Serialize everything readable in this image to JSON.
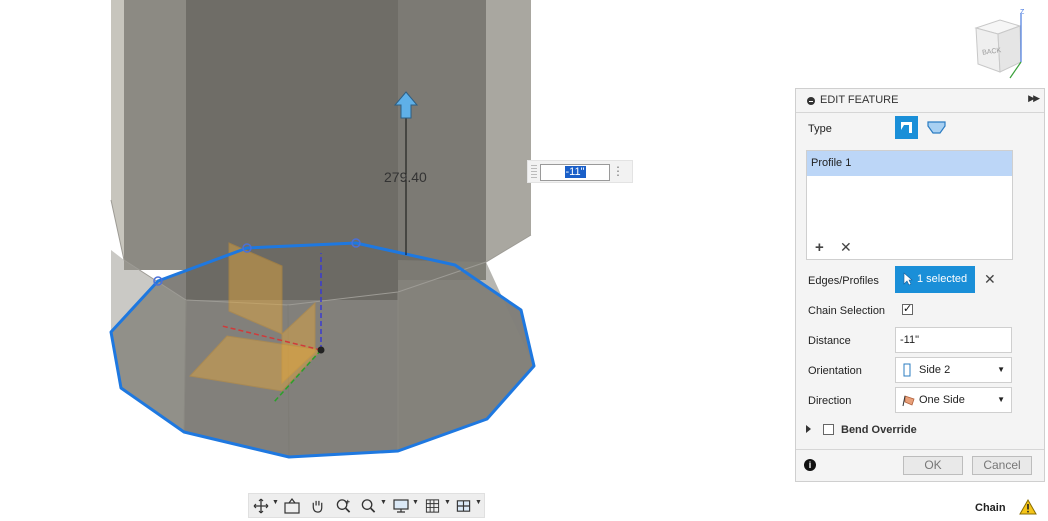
{
  "viewport": {
    "dimension_value": "279.40",
    "distance_input_value": "-11\""
  },
  "viewcube": {
    "face_label": "BACK",
    "axis_label": "Z"
  },
  "panel": {
    "title": "EDIT FEATURE",
    "type_label": "Type",
    "profiles": [
      "Profile 1"
    ],
    "edges_label": "Edges/Profiles",
    "selected_button": "1 selected",
    "chain_label": "Chain Selection",
    "chain_checked": true,
    "distance_label": "Distance",
    "distance_value": "-11\"",
    "orientation_label": "Orientation",
    "orientation_value": "Side 2",
    "direction_label": "Direction",
    "direction_value": "One Side",
    "bend_label": "Bend Override",
    "ok_label": "OK",
    "cancel_label": "Cancel"
  },
  "status": {
    "label": "Chain"
  },
  "colors": {
    "accent": "#1a8fd8",
    "selection_edge": "#1e78e0",
    "selection_row": "#bcd6f7"
  }
}
